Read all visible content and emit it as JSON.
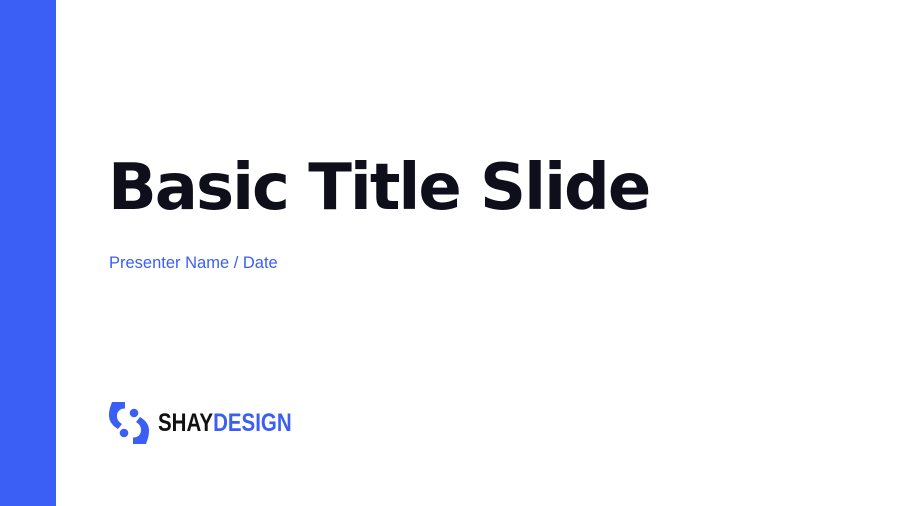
{
  "slide": {
    "title": "Basic Title Slide",
    "subtitle": "Presenter Name / Date"
  },
  "logo": {
    "icon": "s-monogram-logo-icon",
    "word_dark": "SHAY",
    "word_accent": "DESIGN"
  },
  "colors": {
    "accent": "#3b5ef5",
    "title": "#0f0f1c",
    "subtitle": "#3b5ef5",
    "logo_dark": "#111111",
    "background": "#ffffff"
  }
}
